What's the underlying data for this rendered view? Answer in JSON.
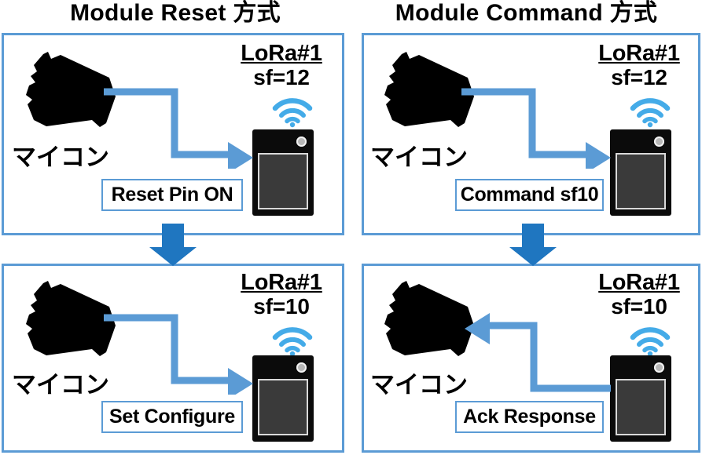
{
  "figure": {
    "columns": [
      {
        "title": "Module Reset 方式"
      },
      {
        "title": "Module Command 方式"
      }
    ]
  },
  "panels": [
    {
      "id": "top-left",
      "column": "Module Reset 方式",
      "step": 1,
      "mcu_label": "マイコン",
      "lora_name": "LoRa#1",
      "lora_sf": "sf=12",
      "caption": "Reset Pin ON",
      "arrow_direction": "mcu-to-lora",
      "wifi_icon": "wifi-icon",
      "device_icon": "lora-module-icon"
    },
    {
      "id": "top-right",
      "column": "Module Command 方式",
      "step": 1,
      "mcu_label": "マイコン",
      "lora_name": "LoRa#1",
      "lora_sf": "sf=12",
      "caption": "Command sf10",
      "arrow_direction": "mcu-to-lora",
      "wifi_icon": "wifi-icon",
      "device_icon": "lora-module-icon"
    },
    {
      "id": "bottom-left",
      "column": "Module Reset 方式",
      "step": 2,
      "mcu_label": "マイコン",
      "lora_name": "LoRa#1",
      "lora_sf": "sf=10",
      "caption": "Set Configure",
      "arrow_direction": "mcu-to-lora",
      "wifi_icon": "wifi-icon",
      "device_icon": "lora-module-icon"
    },
    {
      "id": "bottom-right",
      "column": "Module Command 方式",
      "step": 2,
      "mcu_label": "マイコン",
      "lora_name": "LoRa#1",
      "lora_sf": "sf=10",
      "caption": "Ack Response",
      "arrow_direction": "lora-to-mcu",
      "wifi_icon": "wifi-icon",
      "device_icon": "lora-module-icon"
    }
  ],
  "step_arrows": [
    {
      "id": "step-arrow-left",
      "direction": "down"
    },
    {
      "id": "step-arrow-right",
      "direction": "down"
    }
  ],
  "colors": {
    "panel_border": "#5B9BD5",
    "flow_arrow": "#5B9BD5",
    "step_arrow": "#1F76C0",
    "wifi": "#44ABE8",
    "device_body": "#0B0B0B",
    "device_screen": "#3A3A3A",
    "mcu_body": "#000000",
    "background": "#FFFFFF",
    "text": "#000000"
  }
}
